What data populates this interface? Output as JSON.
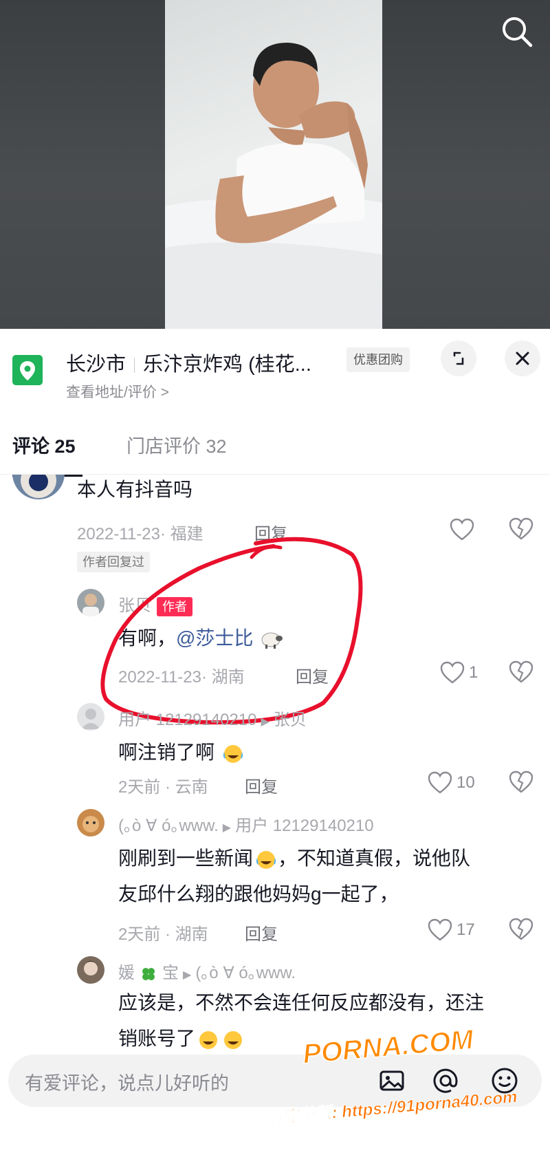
{
  "location": {
    "city": "长沙市",
    "store_name": "乐汴京炸鸡 (桂花...",
    "subtitle": "查看地址/评价 >",
    "deal_tag": "优惠团购"
  },
  "tabs": [
    {
      "label": "评论 25",
      "active": true
    },
    {
      "label": "门店评价 32",
      "active": false
    }
  ],
  "comments": [
    {
      "text": "本人有抖音吗",
      "meta": "2022-11-23· 福建",
      "reply": "回复",
      "author_replied": "作者回复过"
    },
    {
      "username": "张贝",
      "badge": "作者",
      "text_prefix": "有啊，",
      "mention": "@莎士比",
      "meta": "2022-11-23· 湖南",
      "reply": "回复",
      "likes": "1"
    },
    {
      "username": "用户 12129140210",
      "reply_to": "张贝",
      "text": "啊注销了啊",
      "meta": "2天前 · 云南",
      "reply": "回复",
      "likes": "10"
    },
    {
      "username": "(｡ò ∀ ó｡www.",
      "reply_to": "用户 12129140210",
      "text_line1_a": "刚刷到一些新闻",
      "text_line1_b": "，不知道真假，说他队",
      "text_line2": "友邱什么翔的跟他妈妈g一起了，",
      "meta": "2天前 · 湖南",
      "reply": "回复",
      "likes": "17"
    },
    {
      "username_a": "媛",
      "username_b": "宝",
      "reply_to": "(｡ò ∀ ó｡www.",
      "text_line1": "应该是，不然不会连任何反应都没有，还注",
      "text_line2": "销账号了"
    }
  ],
  "input": {
    "placeholder": "有爱评论，说点儿好听的"
  },
  "watermark": {
    "logo": "PORNA.COM",
    "url": "看完整版: https://91porna40.com"
  },
  "colors": {
    "accent_red": "#fe2c55",
    "annotation_red": "#e8102c",
    "mention_blue": "#3c5b9a",
    "location_green": "#1fb35a",
    "watermark_orange": "#ff8a00"
  },
  "icons": [
    "search-icon",
    "location-pin-icon",
    "expand-icon",
    "close-icon",
    "heart-icon",
    "dislike-heart-icon",
    "image-icon",
    "at-icon",
    "emoji-icon"
  ]
}
